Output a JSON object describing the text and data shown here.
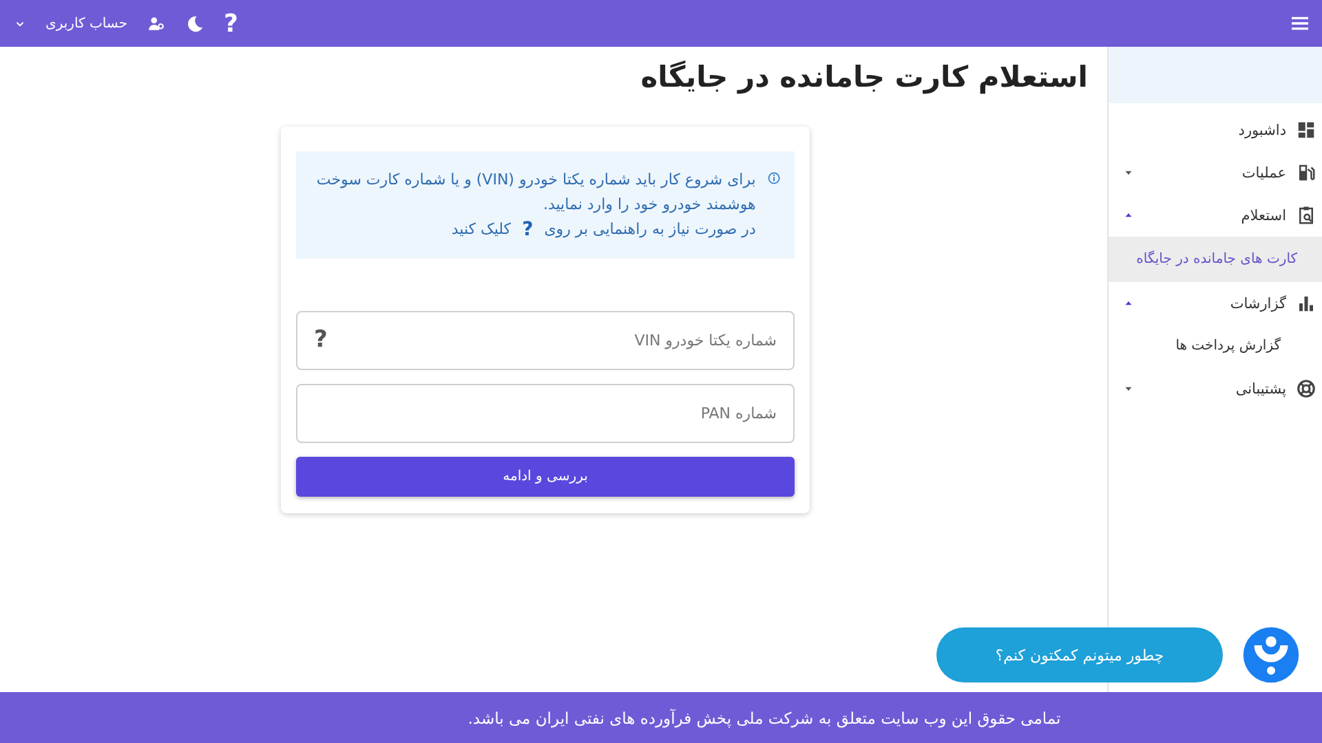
{
  "header": {
    "help": "?",
    "account_label": "حساب کاربری"
  },
  "sidebar": {
    "items": [
      {
        "label": "داشبورد",
        "selected": false
      },
      {
        "label": "عملیات",
        "selected": false,
        "expanded": false
      },
      {
        "label": "استعلام",
        "selected": false,
        "expanded": true,
        "children": [
          {
            "label": "کارت های جامانده در جایگاه",
            "selected": true
          }
        ]
      },
      {
        "label": "گزارشات",
        "selected": false,
        "expanded": true,
        "children": [
          {
            "label": "گزارش پرداخت ها",
            "selected": false
          }
        ]
      },
      {
        "label": "پشتیبانی",
        "selected": false,
        "expanded": false
      }
    ]
  },
  "page": {
    "title": "استعلام کارت جامانده در جایگاه"
  },
  "card": {
    "info": {
      "text": "برای شروع کار باید شماره یکتا خودرو (VIN) و یا شماره کارت سوخت هوشمند خودرو خود را وارد نمایید.",
      "help_before": "در صورت نیاز به راهنمایی بر روی",
      "help_mark": "?",
      "help_after": "کلیک کنید"
    },
    "fields": [
      {
        "placeholder": "شماره یکتا خودرو VIN",
        "help": "?"
      },
      {
        "placeholder": "شماره PAN"
      }
    ],
    "submit": "بررسی و ادامه"
  },
  "chat": {
    "label": "چطور میتونم کمکتون کنم؟"
  },
  "footer": {
    "text": "تمامی حقوق این وب سایت متعلق به شرکت ملی پخش فرآورده های نفتی ایران می باشد."
  }
}
